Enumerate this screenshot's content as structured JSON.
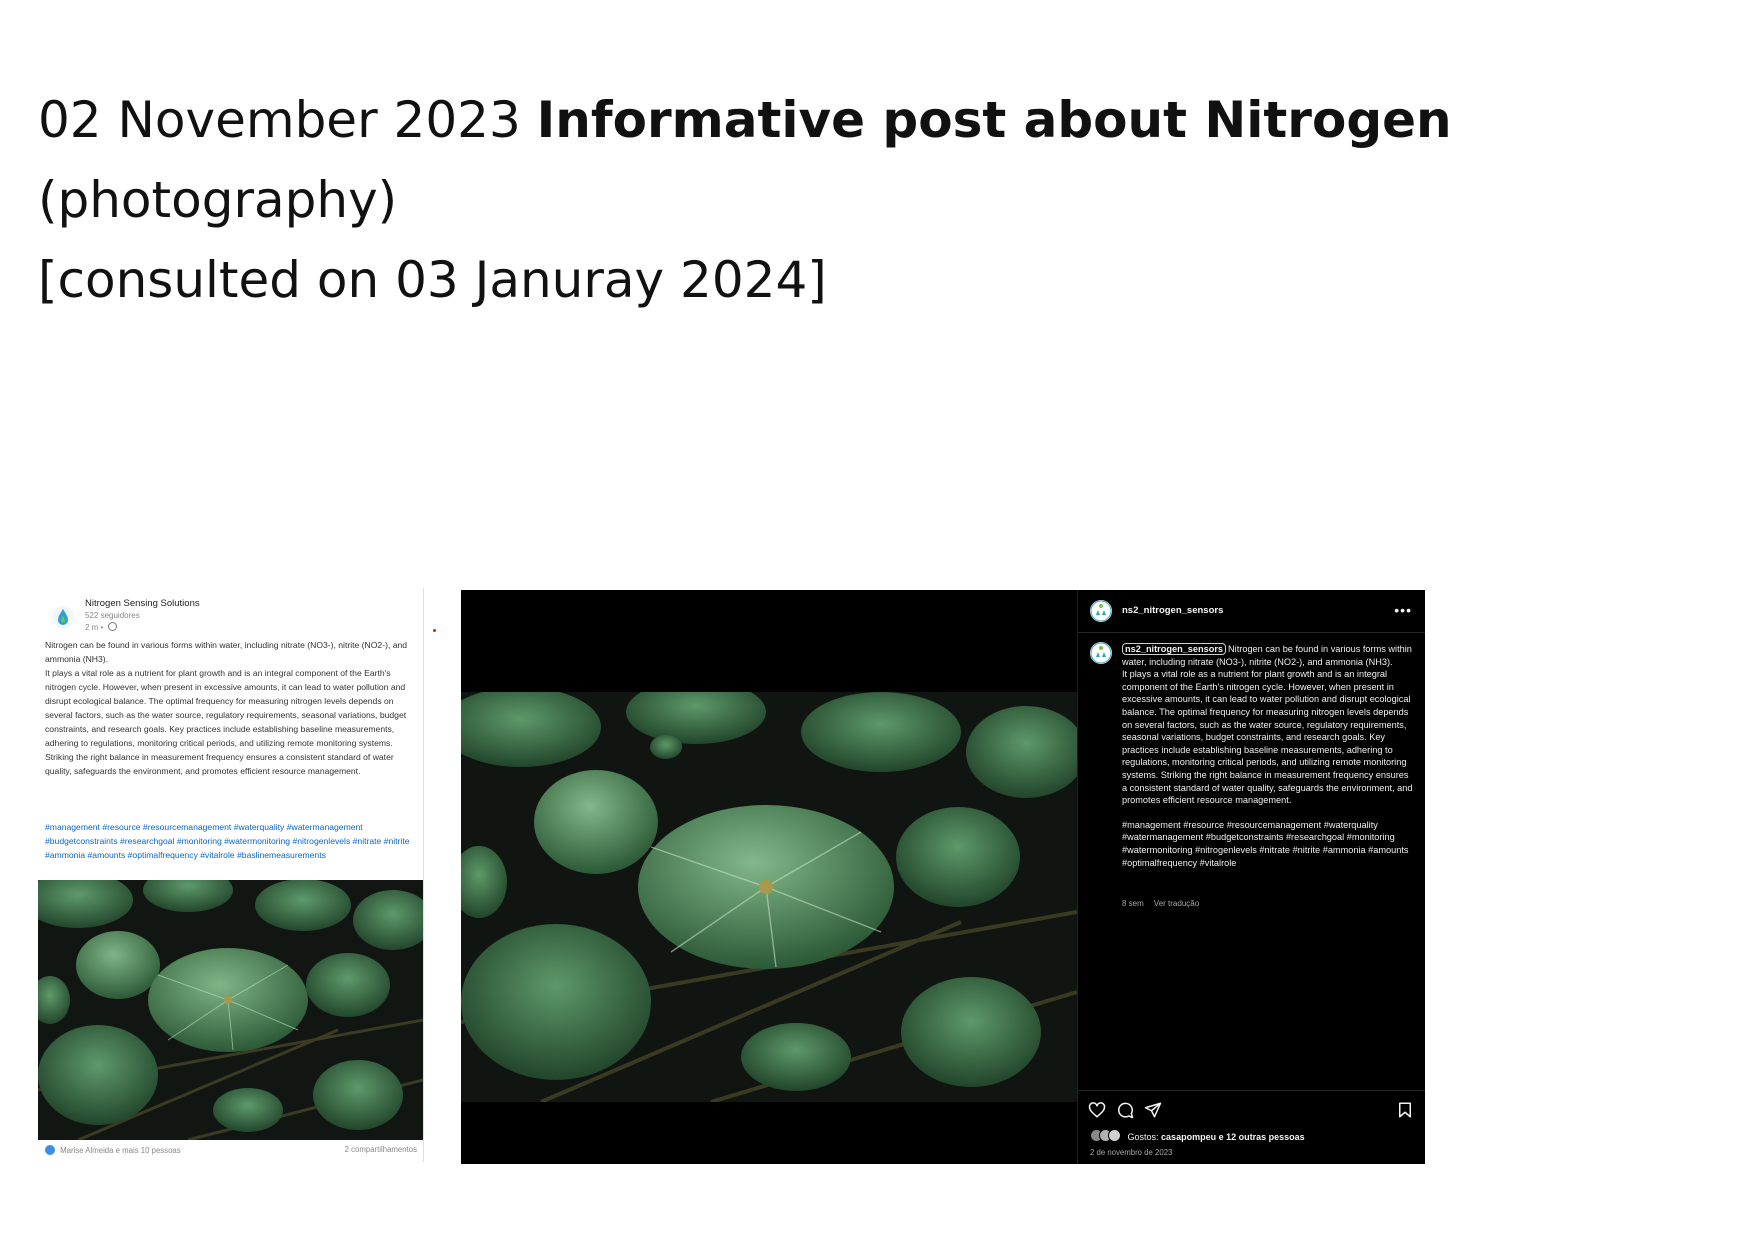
{
  "header": {
    "date": "02 November 2023",
    "title": "Informative post about Nitrogen",
    "subtitle": "(photography)",
    "consulted": "[consulted on 03 Januray 2024]"
  },
  "linkedin": {
    "company": "Nitrogen Sensing Solutions",
    "followers": "522 seguidores",
    "time": "2 m •",
    "body": [
      "Nitrogen can be found in various forms within water, including nitrate (NO3-), nitrite (NO2-), and ammonia (NH3).",
      "It plays a vital role as a nutrient for plant growth and is an integral component of the Earth's nitrogen cycle. However, when present in excessive amounts, it can lead to water pollution and disrupt ecological balance. The optimal frequency for measuring nitrogen levels depends on several factors, such as the water source, regulatory requirements, seasonal variations, budget constraints, and research goals. Key practices include establishing baseline measurements, adhering to regulations, monitoring critical periods, and utilizing remote monitoring systems. Striking the right balance in measurement frequency ensures a consistent standard of water quality, safeguards the environment, and promotes efficient resource management."
    ],
    "hashtags": "#management #resource #resourcemanagement #waterquality #watermanagement #budgetconstraints #researchgoal #monitoring #watermonitoring #nitrogenlevels #nitrate #nitrite #ammonia #amounts #optimalfrequency #vitalrole #baslinemeasurements",
    "reactions": "Marise Almeida e mais 10 pessoas",
    "shares": "2 compartilhamentos",
    "colors": {
      "link": "#0a66c2",
      "reaction": "#378fe9"
    }
  },
  "instagram": {
    "username": "ns2_nitrogen_sensors",
    "more": "•••",
    "caption_user": "ns2_nitrogen_sensors",
    "caption_lines": [
      "Nitrogen can be found in various forms within water, including nitrate (NO3-), nitrite (NO2-), and ammonia (NH3).",
      "It plays a vital role as a nutrient for plant growth and is an integral component of the Earth's nitrogen cycle. However, when present in excessive amounts, it can lead to water pollution and disrupt ecological balance. The optimal frequency for measuring nitrogen levels depends on several factors, such as the water source, regulatory requirements, seasonal variations, budget constraints, and research goals. Key practices include establishing baseline measurements, adhering to regulations, monitoring critical periods, and utilizing remote monitoring systems. Striking the right balance in measurement frequency ensures a consistent standard of water quality, safeguards the environment, and promotes efficient resource management."
    ],
    "hashtags": "#management #resource #resourcemanagement #waterquality #watermanagement #budgetconstraints #researchgoal #monitoring #watermonitoring #nitrogenlevels #nitrate #nitrite #ammonia #amounts #optimalfrequency #vitalrole",
    "age": "8 sem",
    "translate": "Ver tradução",
    "likes_prefix": "Gostos:",
    "likes_user": "casapompeu",
    "likes_suffix": "e 12 outras pessoas",
    "date": "2 de novembro de 2023",
    "icons": [
      "heart-icon",
      "comment-icon",
      "share-icon",
      "bookmark-icon"
    ],
    "colors": {
      "background": "#000000",
      "text": "#f5f5f5",
      "muted": "#a8a8a8"
    }
  }
}
